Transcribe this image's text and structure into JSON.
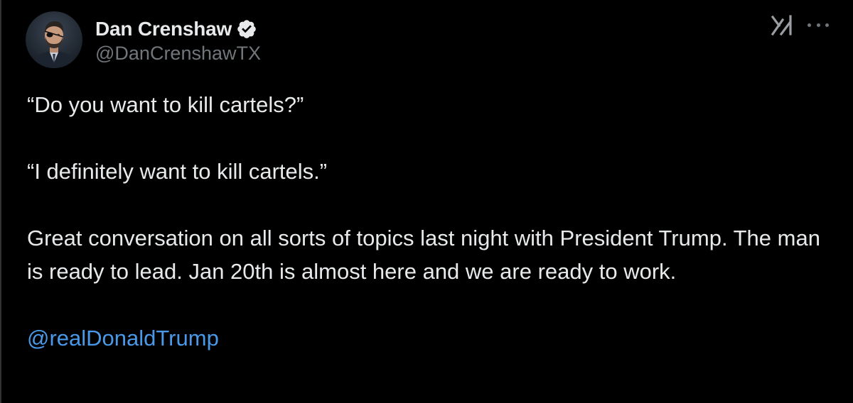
{
  "author": {
    "display_name": "Dan Crenshaw",
    "handle": "@DanCrenshawTX",
    "verified": true,
    "verified_badge_color": "#e7e9ea",
    "avatar_icon": "profile-photo"
  },
  "header_actions": {
    "grok_icon": "grok-icon",
    "more_icon": "more-icon"
  },
  "tweet": {
    "line1": "“Do you want to kill cartels?”",
    "line2": "“I definitely want to kill cartels.”",
    "line3": "Great conversation on all sorts of topics last night with President Trump. The man is ready to lead. Jan 20th is almost here and we are ready to work.",
    "mention": "@realDonaldTrump"
  },
  "colors": {
    "background": "#000000",
    "text": "#e7e9ea",
    "secondary_text": "#71767b",
    "link": "#4a99e9"
  }
}
